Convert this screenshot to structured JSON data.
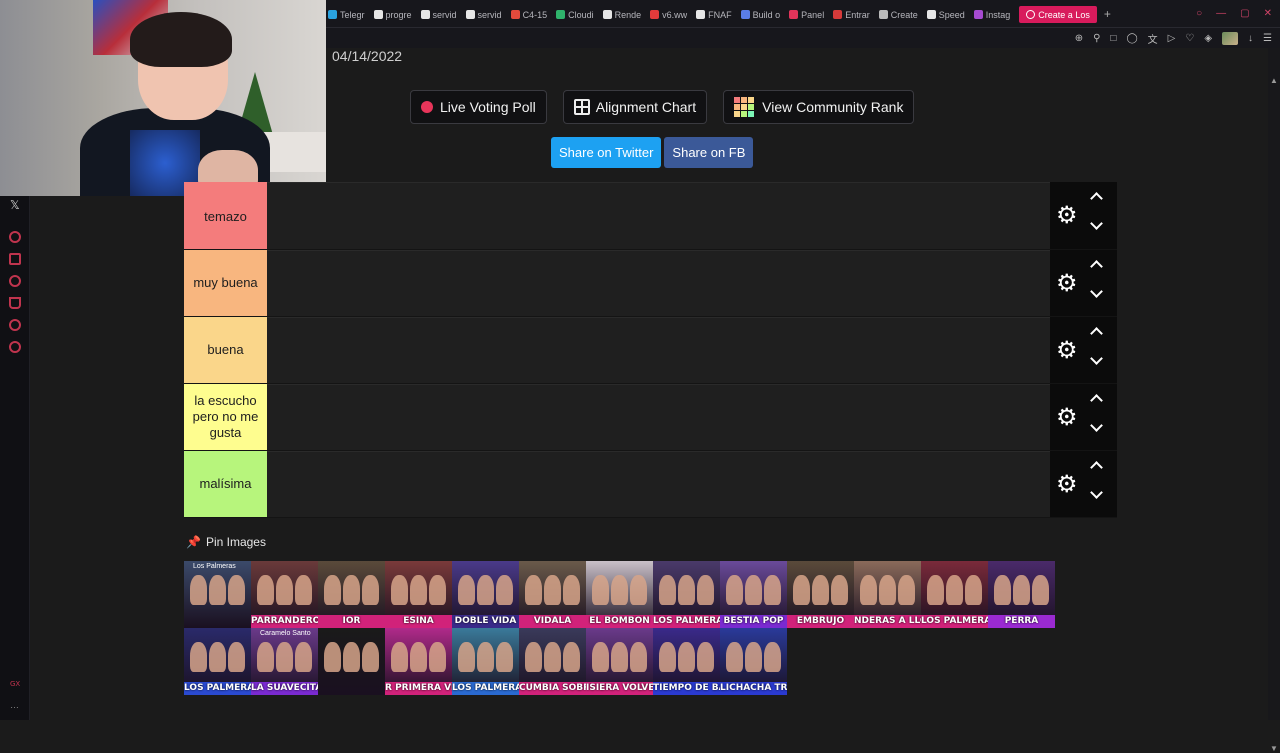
{
  "browser": {
    "tabs": [
      {
        "label": "Telegr",
        "color": "#2aa3e0"
      },
      {
        "label": "progre",
        "color": "#e6e6e6"
      },
      {
        "label": "servid",
        "color": "#e6e6e6"
      },
      {
        "label": "servid",
        "color": "#e6e6e6"
      },
      {
        "label": "C4-15",
        "color": "#e24a3c"
      },
      {
        "label": "Cloudi",
        "color": "#2fb36b"
      },
      {
        "label": "Rende",
        "color": "#e6e6e6"
      },
      {
        "label": "v6.ww",
        "color": "#e23b3b"
      },
      {
        "label": "FNAF",
        "color": "#e6e6e6"
      },
      {
        "label": "Build o",
        "color": "#5a7de8"
      },
      {
        "label": "Panel",
        "color": "#e2345a"
      },
      {
        "label": "Entrar",
        "color": "#d63a3a"
      },
      {
        "label": "Create",
        "color": "#bbbbbb"
      },
      {
        "label": "Speed",
        "color": "#e6e6e6"
      },
      {
        "label": "Instag",
        "color": "#a64bd1"
      },
      {
        "label": "Create a Los",
        "color": "#ffffff",
        "active": true
      }
    ],
    "new_tab": "+"
  },
  "page": {
    "date": "04/14/2022",
    "buttons": {
      "live_poll": "Live Voting Poll",
      "alignment": "Alignment Chart",
      "community": "View Community Rank",
      "twitter": "Share on Twitter",
      "facebook": "Share on FB"
    },
    "tiers": [
      {
        "label": "temazo",
        "color": "#f47c7c"
      },
      {
        "label": "muy buena",
        "color": "#f8b67f"
      },
      {
        "label": "buena",
        "color": "#fad68a"
      },
      {
        "label": "la escucho pero no me gusta",
        "color": "#fefd8f"
      },
      {
        "label": "malísima",
        "color": "#b7f57c"
      }
    ],
    "pin_label": "Pin Images",
    "thumbnails": [
      {
        "caption": "",
        "top": "Los Palmeras",
        "bg": "#3b4a6a",
        "bar": ""
      },
      {
        "caption": "PARRANDERO",
        "top": "",
        "bg": "#6a3a3a",
        "bar": "#d1227a"
      },
      {
        "caption": "IOR",
        "top": "",
        "bg": "#5a4a3a",
        "bar": "#d1227a"
      },
      {
        "caption": "ESINA",
        "top": "",
        "bg": "#7a3a3a",
        "bar": "#d1227a"
      },
      {
        "caption": "DOBLE VIDA",
        "top": "",
        "bg": "#4a3a8a",
        "bar": "#3a2a8a"
      },
      {
        "caption": "VIDALA",
        "top": "",
        "bg": "#6a5a4a",
        "bar": "#d1227a"
      },
      {
        "caption": "EL BOMBON",
        "top": "",
        "bg": "#c9c0c8",
        "bar": "#d1227a"
      },
      {
        "caption": "LOS PALMERAS",
        "top": "",
        "bg": "#4a3a6a",
        "bar": "#d1227a"
      },
      {
        "caption": "BESTIA POP",
        "top": "",
        "bg": "#6a4a9a",
        "bar": "#7a2ad1"
      },
      {
        "caption": "EMBRUJO",
        "top": "",
        "bg": "#5a4a3a",
        "bar": "#d1227a"
      },
      {
        "caption": "NDERAS A LLOR",
        "top": "",
        "bg": "#8a6a5a",
        "bar": "#d1227a"
      },
      {
        "caption": "LOS PALMERAS",
        "top": "",
        "bg": "#7a2a3a",
        "bar": "#d1227a"
      },
      {
        "caption": "PERRA",
        "top": "",
        "bg": "#4a2a6a",
        "bar": "#9a2ad1"
      },
      {
        "caption": "LOS PALMERAS",
        "top": "",
        "bg": "#2a2a6a",
        "bar": "#2a4ad1"
      },
      {
        "caption": "LA SUAVECITA",
        "top": "Caramelo Santo",
        "bg": "#6a3a8a",
        "bar": "#7a2ad1"
      },
      {
        "caption": "",
        "top": "",
        "bg": "#1a1a1a",
        "bar": ""
      },
      {
        "caption": "R PRIMERA VEZ",
        "top": "",
        "bg": "#b02a8a",
        "bar": "#d1227a"
      },
      {
        "caption": "LOS PALMERAS",
        "top": "",
        "bg": "#3a7a9a",
        "bar": "#2a6ad1"
      },
      {
        "caption": "CUMBIA SOBRE EL MAR",
        "top": "",
        "bg": "#3a3a5a",
        "bar": "#d1227a"
      },
      {
        "caption": "ISIERA VOLVER",
        "top": "",
        "bg": "#6a3a8a",
        "bar": "#d1227a"
      },
      {
        "caption": "TIEMPO DE BAIL",
        "top": "",
        "bg": "#3a2a8a",
        "bar": "#2a3ad1"
      },
      {
        "caption": "LICHACHA TRISTE",
        "top": "",
        "bg": "#2a3a9a",
        "bar": "#2a3ad1"
      }
    ]
  },
  "colors": {
    "accent": "#d81b5c",
    "twitter": "#1da1f2",
    "facebook": "#3b5998"
  }
}
